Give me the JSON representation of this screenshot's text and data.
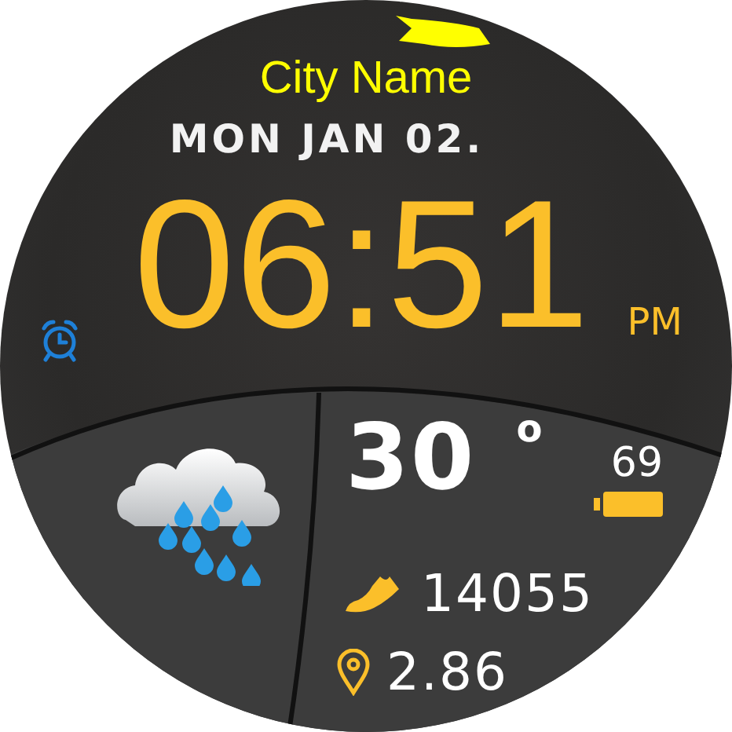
{
  "city": "City Name",
  "date": "MON JAN 02.",
  "time": "06:51",
  "meridiem": "PM",
  "weather": {
    "temperature": "30",
    "degree": "o"
  },
  "battery": {
    "reading": "69"
  },
  "steps": "14055",
  "distance": "2.86"
}
